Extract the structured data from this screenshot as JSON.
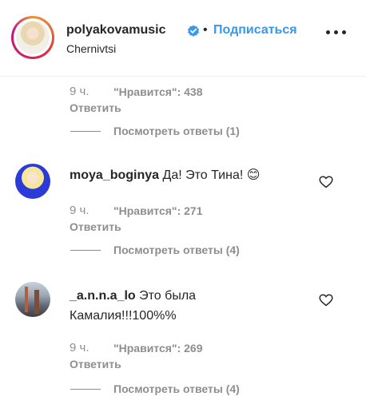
{
  "header": {
    "username": "polyakovamusic",
    "separator": "•",
    "follow_label": "Подписаться",
    "location": "Chernivtsi",
    "icons": [
      "verified-badge-icon",
      "more-options-icon"
    ],
    "accent_color": "#3897f0"
  },
  "comments": [
    {
      "time": "9 ч.",
      "likes": "\"Нравится\": 438",
      "reply_label": "Ответить",
      "view_replies": "Посмотреть ответы (1)"
    },
    {
      "username": "moya_boginya",
      "text": "Да! Это Тина! 😊",
      "time": "9 ч.",
      "likes": "\"Нравится\": 271",
      "reply_label": "Ответить",
      "view_replies": "Посмотреть ответы (4)"
    },
    {
      "username": "_a.n.n.a_lo",
      "text_line1": "Это была",
      "text_line2": "Камалия!!!100%%",
      "time": "9 ч.",
      "likes": "\"Нравится\": 269",
      "reply_label": "Ответить",
      "view_replies": "Посмотреть ответы (4)"
    }
  ]
}
